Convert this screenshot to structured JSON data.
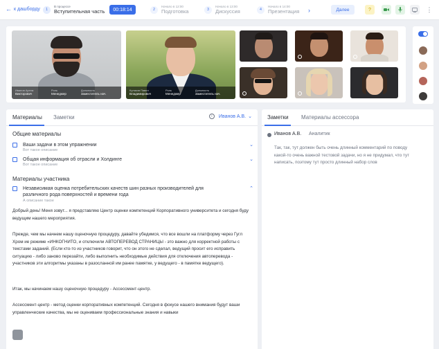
{
  "topbar": {
    "back_label": "к дашборду",
    "steps": [
      {
        "num": "1",
        "sub": "В процессе",
        "name": "Вступительная часть"
      },
      {
        "num": "2",
        "sub": "Начало в 12:00",
        "name": "Подготовка"
      },
      {
        "num": "3",
        "sub": "Начало в 13:00",
        "name": "Дискуссия"
      },
      {
        "num": "4",
        "sub": "Начало в 14:00",
        "name": "Презентация"
      }
    ],
    "timer": "00:18:14",
    "next_label": "Далее",
    "help_glyph": "?"
  },
  "participants": [
    {
      "name_key": "Иванов Артем",
      "name": "Викторович",
      "role_key": "Роль",
      "role": "Менеджер",
      "pos_key": "Должность",
      "pos": "Заместитель нач."
    },
    {
      "name_key": "Куликов Павел",
      "name": "Владимирович",
      "role_key": "Роль",
      "role": "Менеджер",
      "pos_key": "Должность",
      "pos": "Заместитель нач."
    }
  ],
  "materials": {
    "tabs": [
      "Материалы",
      "Заметки"
    ],
    "selected_person": "Иванов А.В.",
    "info_glyph": "i",
    "common_title": "Общие материалы",
    "common_items": [
      {
        "title": "Ваши задачи в этом упражнении",
        "desc": "Вот такое описание"
      },
      {
        "title": "Общая информация об отрасли и Холдинге",
        "desc": "Вот такое описание"
      }
    ],
    "participant_title": "Материалы участника",
    "participant_item": {
      "title_line1": "Независимая оценка потребительских качеств шин разных производителей для",
      "title_line2": "различного рода поверхностей и времени года",
      "desc": "А описание такое"
    },
    "paragraphs": [
      "Добрый день! Меня зовут... я представляю Центр оценки компетенций Корпоративного университета и сегодня буду ведущим нашего мероприятия.",
      "Прежде, чем мы начнем нашу оценочную процедуру, давайте убедимся, что все вошли на платформу через Гугл Хром ие режиме «ИНКОГНИТО, и отключили АВТОПЕРЕВОД СТРАНИЦЫ - это важно для корректной работы с текстами заданий. (Если кто-то из участников говорит, что он этого не сделал, ведущий просит его исправить ситуацию - либо заново перезайти, либо выполнить необходимые действия для отключения автоперевода - участников эти алгоритмы указаны в разосланной им ранее памятке, у ведущего - в памятке ведущего).",
      "Итак, мы начинаем нашу оценочную процедуру - Ассессмент-центр.",
      "Ассессмент-центр - метод оценки корпоративных компетенций. Сегодня в фокусе нашего внимания будут ваши управленческие качества, мы не оцениваем профессиональные знания и навыки"
    ]
  },
  "notes": {
    "tabs": [
      "Заметки",
      "Материалы ассессора"
    ],
    "author": "Иванов А.В.",
    "role": "Аналитик",
    "text": "Так, так, тут должен быть очень длинный комментарий по поводу какой-то очень важной тестовой задачи, но я не придумал, что тут написать, поэтому тут просто длинный набор слов"
  },
  "colors": {
    "accent": "#3a6ee8",
    "timer_bg": "#3a6ee8"
  }
}
